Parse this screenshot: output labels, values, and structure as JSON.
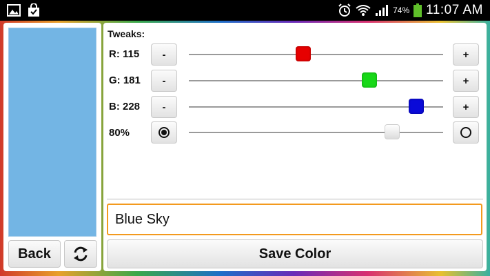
{
  "status_bar": {
    "battery_text": "74%",
    "time": "11:07 AM",
    "icons": [
      "gallery-icon",
      "shopping-bag-icon",
      "alarm-icon",
      "wifi-icon",
      "signal-icon",
      "battery-icon"
    ]
  },
  "swatch": {
    "color": "#73b5e4"
  },
  "left_buttons": {
    "back_label": "Back"
  },
  "tweaks": {
    "title": "Tweaks:",
    "minus_label": "-",
    "plus_label": "+",
    "rows": [
      {
        "label": "R: 115",
        "value": 115,
        "max": 255,
        "thumb_color": "#e60000"
      },
      {
        "label": "G: 181",
        "value": 181,
        "max": 255,
        "thumb_color": "#18d818"
      },
      {
        "label": "B: 228",
        "value": 228,
        "max": 255,
        "thumb_color": "#0a0ad8"
      },
      {
        "label": "80%",
        "value": 80,
        "max": 100,
        "thumb_color": "#f0f0f0"
      }
    ]
  },
  "name_input": {
    "value": "Blue Sky"
  },
  "save_button": {
    "label": "Save Color"
  },
  "colors": {
    "input_focus": "#f39a1e"
  }
}
